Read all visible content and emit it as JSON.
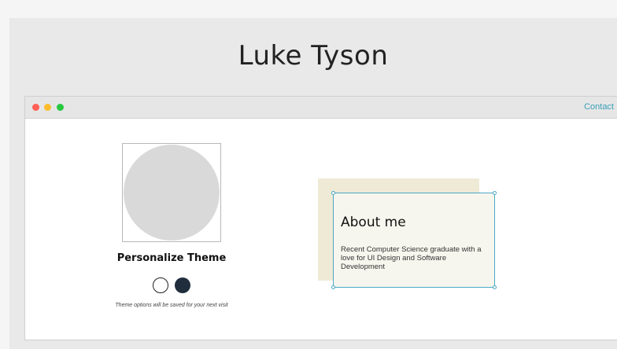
{
  "header": {
    "name": "Luke Tyson"
  },
  "browser": {
    "window_controls": [
      "close",
      "minimize",
      "maximize"
    ],
    "nav": {
      "contact_label": "Contact"
    },
    "colors": {
      "close": "#ff5f57",
      "minimize": "#febc2e",
      "maximize": "#28c840",
      "accent": "#3aa0b8"
    }
  },
  "profile": {
    "theme_heading": "Personalize Theme",
    "theme_options": [
      "light",
      "dark"
    ],
    "theme_colors": {
      "light": "#ffffff",
      "dark": "#1f2d3d"
    },
    "theme_note": "Theme options will be saved for your next visit"
  },
  "about": {
    "title": "About me",
    "text": "Recent Computer Science graduate with a love for UI Design and Software Development"
  }
}
